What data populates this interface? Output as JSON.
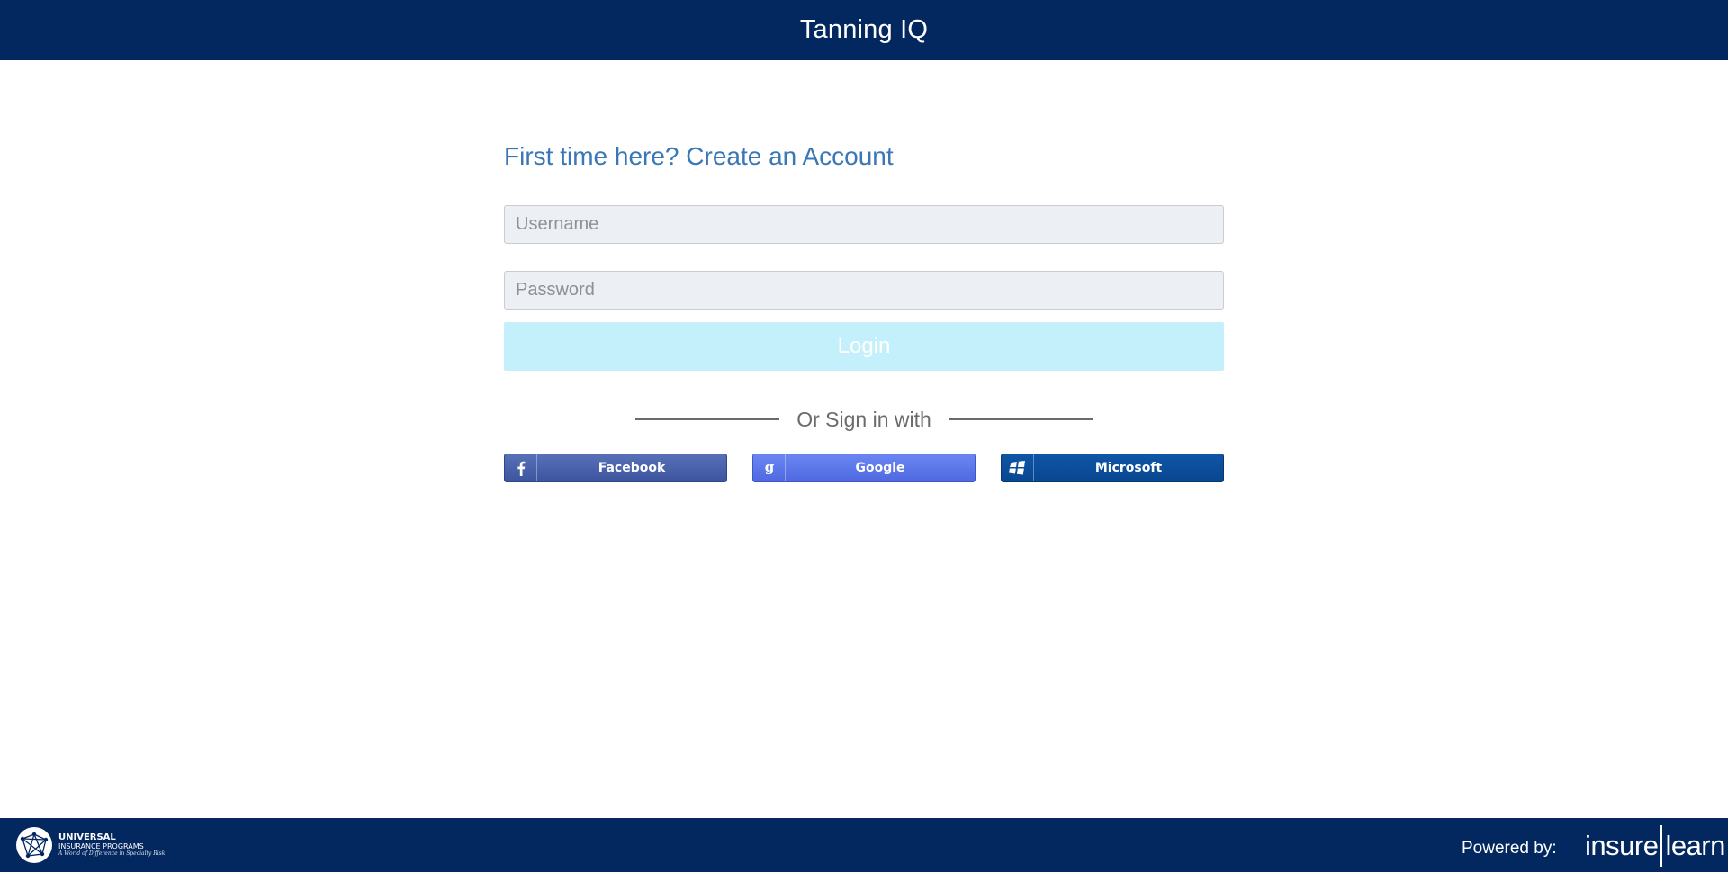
{
  "header": {
    "title": "Tanning IQ"
  },
  "form": {
    "create_account_link": "First time here? Create an Account",
    "username": {
      "placeholder": "Username",
      "value": ""
    },
    "password": {
      "placeholder": "Password",
      "value": ""
    },
    "login_label": "Login",
    "divider_text": "Or Sign in with",
    "social": [
      {
        "label": "Facebook",
        "icon": "facebook-icon",
        "color": "#4a62ad"
      },
      {
        "label": "Google",
        "icon": "google-icon",
        "color": "#5d78ea"
      },
      {
        "label": "Microsoft",
        "icon": "windows-icon",
        "color": "#0b4e9b"
      }
    ]
  },
  "footer": {
    "sponsor_logo": {
      "name": "UNIVERSAL",
      "subtitle": "INSURANCE PROGRAMS",
      "tagline": "A World of Difference in Specialty Risk"
    },
    "powered_by": "Powered by:",
    "brand_logo": {
      "left": "insure",
      "right": "learn"
    }
  },
  "colors": {
    "navy": "#03275f",
    "link": "#3a77b6",
    "login_bg": "#c4f0fc",
    "input_bg": "#eceff3"
  }
}
